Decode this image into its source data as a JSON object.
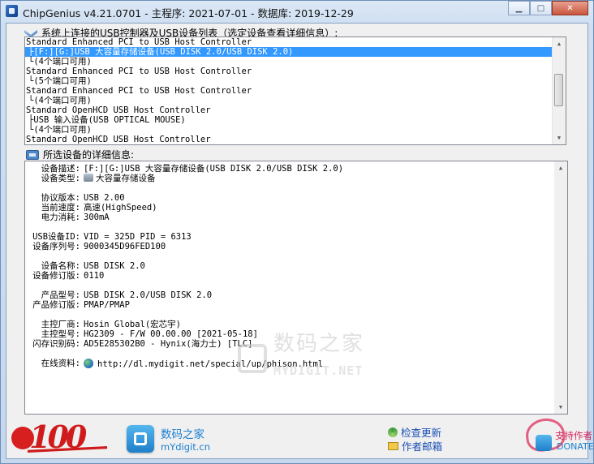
{
  "window": {
    "title": "ChipGenius v4.21.0701 - 主程序: 2021-07-01 - 数据库: 2019-12-29",
    "controls": {
      "minimize": "▁",
      "maximize": "□",
      "close": "✕"
    }
  },
  "device_list": {
    "label": "系统上连接的USB控制器及USB设备列表（选定设备查看详细信息）:",
    "rows": [
      {
        "text": "Standard Enhanced PCI to USB Host Controller",
        "level": 0
      },
      {
        "text": "├[F:][G:]USB 大容量存储设备(USB DISK 2.0/USB DISK 2.0)",
        "level": 1,
        "selected": true
      },
      {
        "text": "└(4个端口可用)",
        "level": 1
      },
      {
        "text": "Standard Enhanced PCI to USB Host Controller",
        "level": 0
      },
      {
        "text": "└(5个端口可用)",
        "level": 1
      },
      {
        "text": "Standard Enhanced PCI to USB Host Controller",
        "level": 0
      },
      {
        "text": "└(4个端口可用)",
        "level": 1
      },
      {
        "text": "Standard OpenHCD USB Host Controller",
        "level": 0
      },
      {
        "text": "├USB 输入设备(USB OPTICAL MOUSE)",
        "level": 1
      },
      {
        "text": "└(4个端口可用)",
        "level": 1
      },
      {
        "text": "Standard OpenHCD USB Host Controller",
        "level": 0
      }
    ],
    "scroll": {
      "up": "▲",
      "down": "▼"
    }
  },
  "details": {
    "label": "所选设备的详细信息:",
    "fields": [
      {
        "label": "设备描述:",
        "value": "[F:][G:]USB 大容量存储设备(USB DISK 2.0/USB DISK 2.0)"
      },
      {
        "label": "设备类型:",
        "value": "大容量存储设备",
        "icon": "disk-icon"
      },
      {
        "label": "协议版本:",
        "value": "USB 2.00"
      },
      {
        "label": "当前速度:",
        "value": "高速(HighSpeed)"
      },
      {
        "label": "电力消耗:",
        "value": "300mA"
      },
      {
        "label": "USB设备ID:",
        "value": "VID = 325D PID = 6313"
      },
      {
        "label": "设备序列号:",
        "value": "9000345D96FED100"
      },
      {
        "label": "设备名称:",
        "value": "USB DISK 2.0"
      },
      {
        "label": "设备修订版:",
        "value": "0110"
      },
      {
        "label": "产品型号:",
        "value": "USB DISK 2.0/USB DISK 2.0"
      },
      {
        "label": "产品修订版:",
        "value": "PMAP/PMAP"
      },
      {
        "label": "主控厂商:",
        "value": "Hosin Global(宏芯宇)"
      },
      {
        "label": "主控型号:",
        "value": "HG2309 - F/W 00.00.00 [2021-05-18]"
      },
      {
        "label": "闪存识别码:",
        "value": "AD5E285302B0 - Hynix(海力士) [TLC]"
      },
      {
        "label": "在线资料:",
        "value": "http://dl.mydigit.net/special/up/phison.html",
        "icon": "globe-icon"
      }
    ],
    "watermark": {
      "line1": "数码之家",
      "line2": "MYDIGIT.NET"
    },
    "scroll": {
      "up": "▲",
      "down": "▼"
    }
  },
  "footer": {
    "party_logo_text": "100",
    "brand": {
      "name": "数码之家",
      "url": "mYdigit.cn"
    },
    "check_update": "检查更新",
    "author_email": "作者邮箱",
    "donate": {
      "line1": "支持作者",
      "line2": "DONATE"
    }
  }
}
